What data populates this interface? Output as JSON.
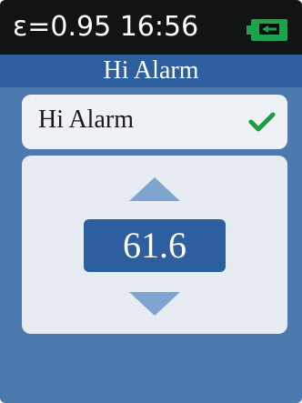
{
  "status": {
    "emissivity_text": "ε=0.95",
    "time": "16:56",
    "battery_icon": "battery-charging-icon",
    "battery_color": "#1aa34a"
  },
  "header": {
    "title": "Hi Alarm"
  },
  "item": {
    "label": "Hi Alarm",
    "check_icon": "check-icon",
    "check_color": "#1a9d43"
  },
  "setting": {
    "value": "61.6",
    "up_icon": "arrow-up-icon",
    "down_icon": "arrow-down-icon"
  }
}
